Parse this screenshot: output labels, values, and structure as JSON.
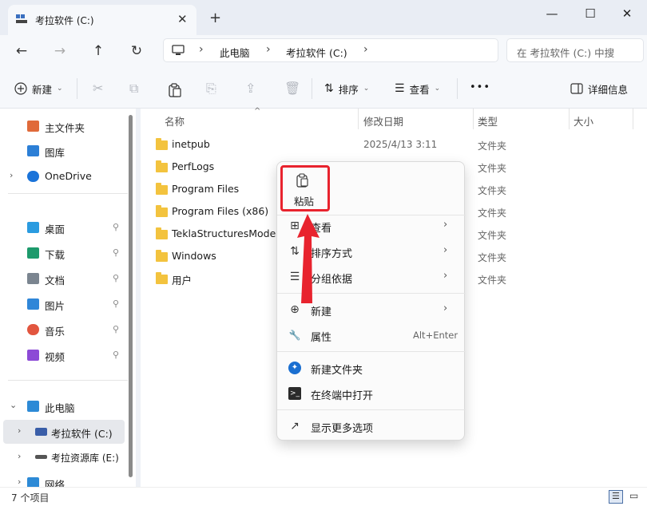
{
  "window": {
    "tab_title": "考拉软件 (C:)",
    "new_tab": "+",
    "minimize": "—",
    "maximize": "☐",
    "close": "✕",
    "tab_close": "✕"
  },
  "nav": {
    "back": "←",
    "forward": "→",
    "up": "↑",
    "refresh": "↻",
    "breadcrumb": [
      "此电脑",
      "考拉软件 (C:)"
    ],
    "sep": "›",
    "search_placeholder": "在 考拉软件 (C:) 中搜"
  },
  "toolbar": {
    "new_label": "新建",
    "sort_label": "排序",
    "view_label": "查看",
    "more": "•••",
    "details_label": "详细信息"
  },
  "sidebar": {
    "items": [
      {
        "label": "主文件夹",
        "icon": "home-icon",
        "color": "#e06a3a"
      },
      {
        "label": "图库",
        "icon": "gallery-icon",
        "color": "#2c7fd6"
      },
      {
        "label": "OneDrive",
        "icon": "cloud-icon",
        "color": "#1a73d9",
        "arrow": "›"
      },
      {
        "label": "桌面",
        "icon": "desktop-icon",
        "color": "#2a9be0",
        "pin": "📌"
      },
      {
        "label": "下载",
        "icon": "download-icon",
        "color": "#1d9a6c",
        "pin": "📌"
      },
      {
        "label": "文档",
        "icon": "document-icon",
        "color": "#7b8590",
        "pin": "📌"
      },
      {
        "label": "图片",
        "icon": "pictures-icon",
        "color": "#2f86d8",
        "pin": "📌"
      },
      {
        "label": "音乐",
        "icon": "music-icon",
        "color": "#e2563f",
        "pin": "📌"
      },
      {
        "label": "视频",
        "icon": "video-icon",
        "color": "#8c4ad6",
        "pin": "📌"
      },
      {
        "label": "此电脑",
        "icon": "computer-icon",
        "color": "#2d8ad6",
        "arrow": "⌄"
      },
      {
        "label": "考拉软件 (C:)",
        "icon": "drive-icon",
        "color": "#3a5ea8",
        "arrow": "›"
      },
      {
        "label": "考拉资源库 (E:)",
        "icon": "drive-icon",
        "color": "#555555",
        "arrow": "›"
      },
      {
        "label": "网络",
        "icon": "network-icon",
        "color": "#2d8ad6",
        "arrow": "›"
      }
    ]
  },
  "columns": {
    "name": "名称",
    "date": "修改日期",
    "type": "类型",
    "size": "大小"
  },
  "files": [
    {
      "name": "inetpub",
      "date": "2025/4/13 3:11",
      "type": "文件夹"
    },
    {
      "name": "PerfLogs",
      "date": "",
      "type": "文件夹"
    },
    {
      "name": "Program Files",
      "date": "",
      "type": "文件夹"
    },
    {
      "name": "Program Files (x86)",
      "date": "",
      "type": "文件夹"
    },
    {
      "name": "TeklaStructuresModels",
      "date": "",
      "type": "文件夹"
    },
    {
      "name": "Windows",
      "date": "",
      "type": "文件夹"
    },
    {
      "name": "用户",
      "date": "",
      "type": "文件夹"
    }
  ],
  "status": {
    "count": "7 个项目"
  },
  "context_menu": {
    "paste": "粘贴",
    "items": [
      {
        "label": "查看",
        "icon": "grid-icon",
        "glyph": "⊞",
        "chev": "›"
      },
      {
        "label": "排序方式",
        "icon": "sort-icon",
        "glyph": "⇅",
        "chev": "›"
      },
      {
        "label": "分组依据",
        "icon": "group-icon",
        "glyph": "☰",
        "chev": "›"
      },
      {
        "label": "新建",
        "icon": "plus-circle-icon",
        "glyph": "⊕",
        "chev": "›"
      },
      {
        "label": "属性",
        "icon": "wrench-icon",
        "glyph": "🔧",
        "key": "Alt+Enter"
      },
      {
        "label": "新建文件夹",
        "icon": "new-folder-icon",
        "glyph": "✦"
      },
      {
        "label": "在终端中打开",
        "icon": "terminal-icon",
        "glyph": ">_"
      },
      {
        "label": "显示更多选项",
        "icon": "more-options-icon",
        "glyph": "↗"
      }
    ]
  },
  "colors": {
    "accent": "#0067c0",
    "highlight": "#e8232e",
    "folder": "#f3c33e"
  }
}
